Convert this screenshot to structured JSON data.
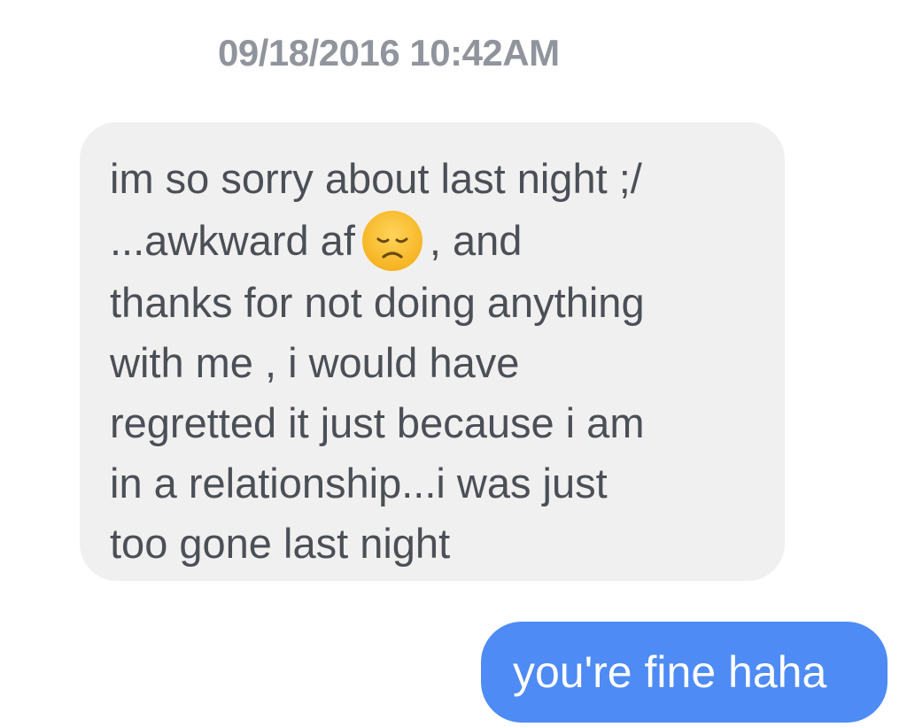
{
  "conversation": {
    "timestamp": "09/18/2016 10:42AM",
    "incoming_message": {
      "line1": "im so sorry about last night ;/",
      "line2_before_emoji": "...awkward af",
      "emoji": "disappointed-face-icon",
      "line2_after_emoji": ", and",
      "line3": "thanks for not doing anything",
      "line4": "with me , i would have",
      "line5": "regretted it just because i am",
      "line6": "in a relationship...i was just",
      "line7": "too gone last night"
    },
    "outgoing_message": {
      "text": "you're fine haha"
    }
  },
  "colors": {
    "incoming_bubble": "#f1f0f0",
    "outgoing_bubble": "#4e8bf5",
    "timestamp_text": "#90949c",
    "incoming_text": "#4b4f56",
    "outgoing_text": "#ffffff"
  }
}
